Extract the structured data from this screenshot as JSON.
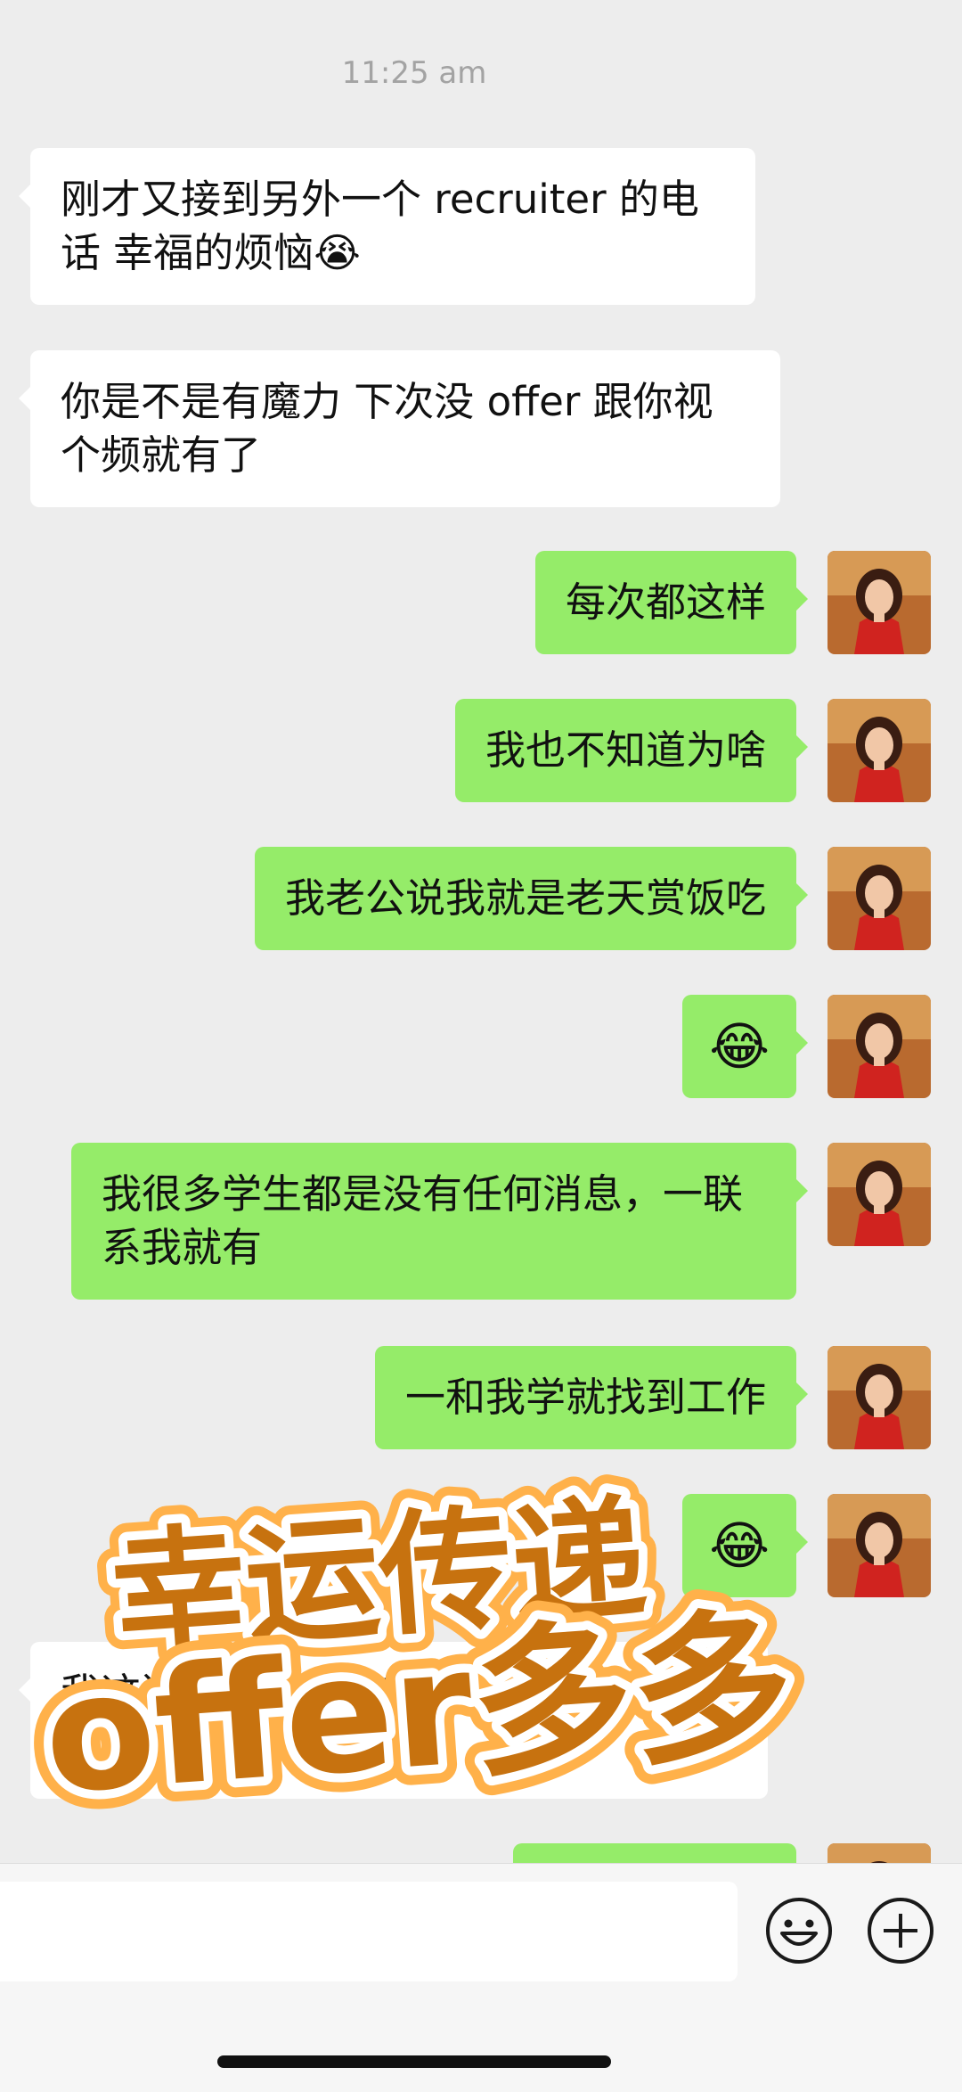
{
  "chat": {
    "timestamp": "11:25 am",
    "messages": [
      {
        "side": "left",
        "text": "刚才又接到另外一个 recruiter 的电话 幸福的烦恼😭"
      },
      {
        "side": "left",
        "text": "你是不是有魔力 下次没 offer 跟你视个频就有了"
      },
      {
        "side": "right",
        "text": "每次都这样"
      },
      {
        "side": "right",
        "text": "我也不知道为啥"
      },
      {
        "side": "right",
        "text": "我老公说我就是老天赏饭吃"
      },
      {
        "side": "right",
        "text": "😂"
      },
      {
        "side": "right",
        "text": "我很多学生都是没有任何消息，一联系我就有"
      },
      {
        "side": "right",
        "text": "一和我学就找到工作"
      },
      {
        "side": "right",
        "text": "😂"
      },
      {
        "side": "left",
        "text": "我这还没……上呢就来……给你……啊"
      }
    ]
  },
  "overlay": {
    "line1": "幸运传递",
    "line2": "offer多多",
    "fill_color": "#c7720f",
    "outline_color": "#ffffff",
    "glow_color": "#ff9a1f"
  },
  "input_bar": {
    "emoji_icon": "smiley-icon",
    "add_icon": "plus-circle-icon"
  },
  "colors": {
    "background": "#ededed",
    "bubble_mine": "#95ec69",
    "bubble_theirs": "#ffffff",
    "timestamp": "#a3a3a3"
  }
}
